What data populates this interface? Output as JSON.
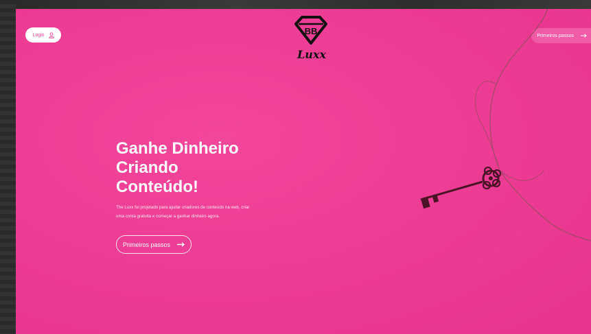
{
  "header": {
    "login": {
      "label": "Login",
      "icon": "user-icon"
    },
    "logo": {
      "monogram": "BB",
      "wordmark": "Luxx"
    },
    "cta": {
      "label": "Primeiros passos",
      "icon": "arrow-right-icon"
    }
  },
  "hero": {
    "title_lines": [
      "Ganhe Dinheiro",
      "Criando",
      "Conteúdo!"
    ],
    "description": "The Luxx foi projetado para ajudar criadores de conteúdo na web, criar uma conta gratuita e começar a ganhar dinheiro agora.",
    "button": {
      "label": "Primeiros passos",
      "icon": "arrow-right-icon"
    }
  },
  "image": {
    "subject": "vintage-key-on-string",
    "icon": "key-icon"
  },
  "colors": {
    "background": "#ec3b93",
    "white": "#ffffff",
    "accent_text": "#ec3b93",
    "logo": "#111111"
  }
}
